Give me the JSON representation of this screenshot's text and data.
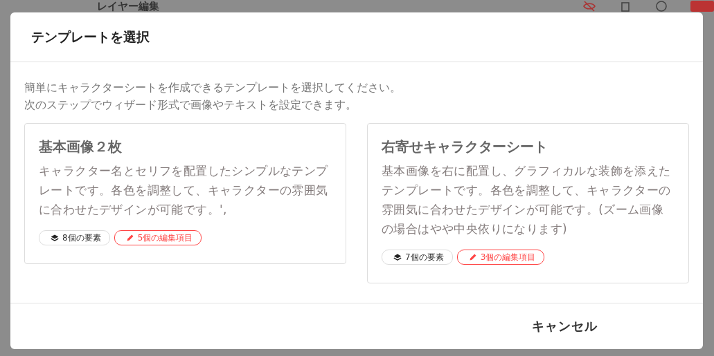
{
  "background": {
    "title": "レイヤー編集"
  },
  "dialog": {
    "title": "テンプレートを選択",
    "description": [
      "簡単にキャラクターシートを作成できるテンプレートを選択してください。",
      "次のステップでウィザード形式で画像やテキストを設定できます。"
    ],
    "templates": [
      {
        "title": "基本画像２枚",
        "description": "キャラクター名とセリフを配置したシンプルなテンプレートです。各色を調整して、キャラクターの雰囲気に合わせたデザインが可能です。',",
        "elements": "8個の要素",
        "edit_items": "5個の編集項目"
      },
      {
        "title": "右寄せキャラクターシート",
        "description": "基本画像を右に配置し、グラフィカルな装飾を添えたテンプレートです。各色を調整して、キャラクターの雰囲気に合わせたデザインが可能です。(ズーム画像の場合はやや中央依りになります)",
        "elements": "7個の要素",
        "edit_items": "3個の編集項目"
      }
    ],
    "buttons": [
      {
        "label": "キャンセル"
      }
    ]
  }
}
